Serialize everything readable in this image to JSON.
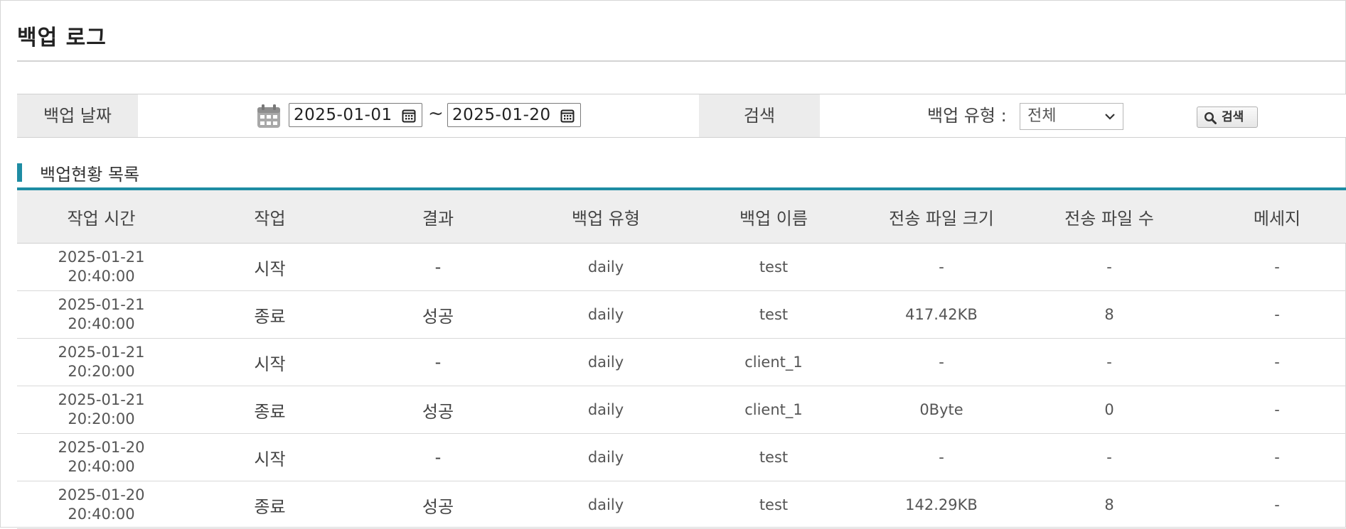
{
  "page": {
    "title": "백업 로그"
  },
  "search": {
    "date_label": "백업 날짜",
    "date_from": "2025-01-01",
    "date_separator": "~",
    "date_to": "2025-01-20",
    "search_label": "검색",
    "type_label": "백업 유형 :",
    "type_value": "전체",
    "button_label": "검색"
  },
  "section": {
    "title": "백업현황 목록"
  },
  "table": {
    "columns": [
      "작업 시간",
      "작업",
      "결과",
      "백업 유형",
      "백업 이름",
      "전송 파일 크기",
      "전송 파일 수",
      "메세지"
    ],
    "rows": [
      {
        "date": "2025-01-21",
        "time": "20:40:00",
        "job": "시작",
        "result": "-",
        "type": "daily",
        "name": "test",
        "size": "-",
        "count": "-",
        "message": "-"
      },
      {
        "date": "2025-01-21",
        "time": "20:40:00",
        "job": "종료",
        "result": "성공",
        "type": "daily",
        "name": "test",
        "size": "417.42KB",
        "count": "8",
        "message": "-"
      },
      {
        "date": "2025-01-21",
        "time": "20:20:00",
        "job": "시작",
        "result": "-",
        "type": "daily",
        "name": "client_1",
        "size": "-",
        "count": "-",
        "message": "-"
      },
      {
        "date": "2025-01-21",
        "time": "20:20:00",
        "job": "종료",
        "result": "성공",
        "type": "daily",
        "name": "client_1",
        "size": "0Byte",
        "count": "0",
        "message": "-"
      },
      {
        "date": "2025-01-20",
        "time": "20:40:00",
        "job": "시작",
        "result": "-",
        "type": "daily",
        "name": "test",
        "size": "-",
        "count": "-",
        "message": "-"
      },
      {
        "date": "2025-01-20",
        "time": "20:40:00",
        "job": "종료",
        "result": "성공",
        "type": "daily",
        "name": "test",
        "size": "142.29KB",
        "count": "8",
        "message": "-"
      }
    ]
  },
  "colors": {
    "accent": "#1e8ca3",
    "header_bg": "#eeeeee",
    "label_bg": "#ececec"
  },
  "icons": {
    "calendar": "calendar-icon",
    "date_picker": "date-picker-icon",
    "dropdown": "chevron-down-icon",
    "search": "magnifier-icon"
  }
}
